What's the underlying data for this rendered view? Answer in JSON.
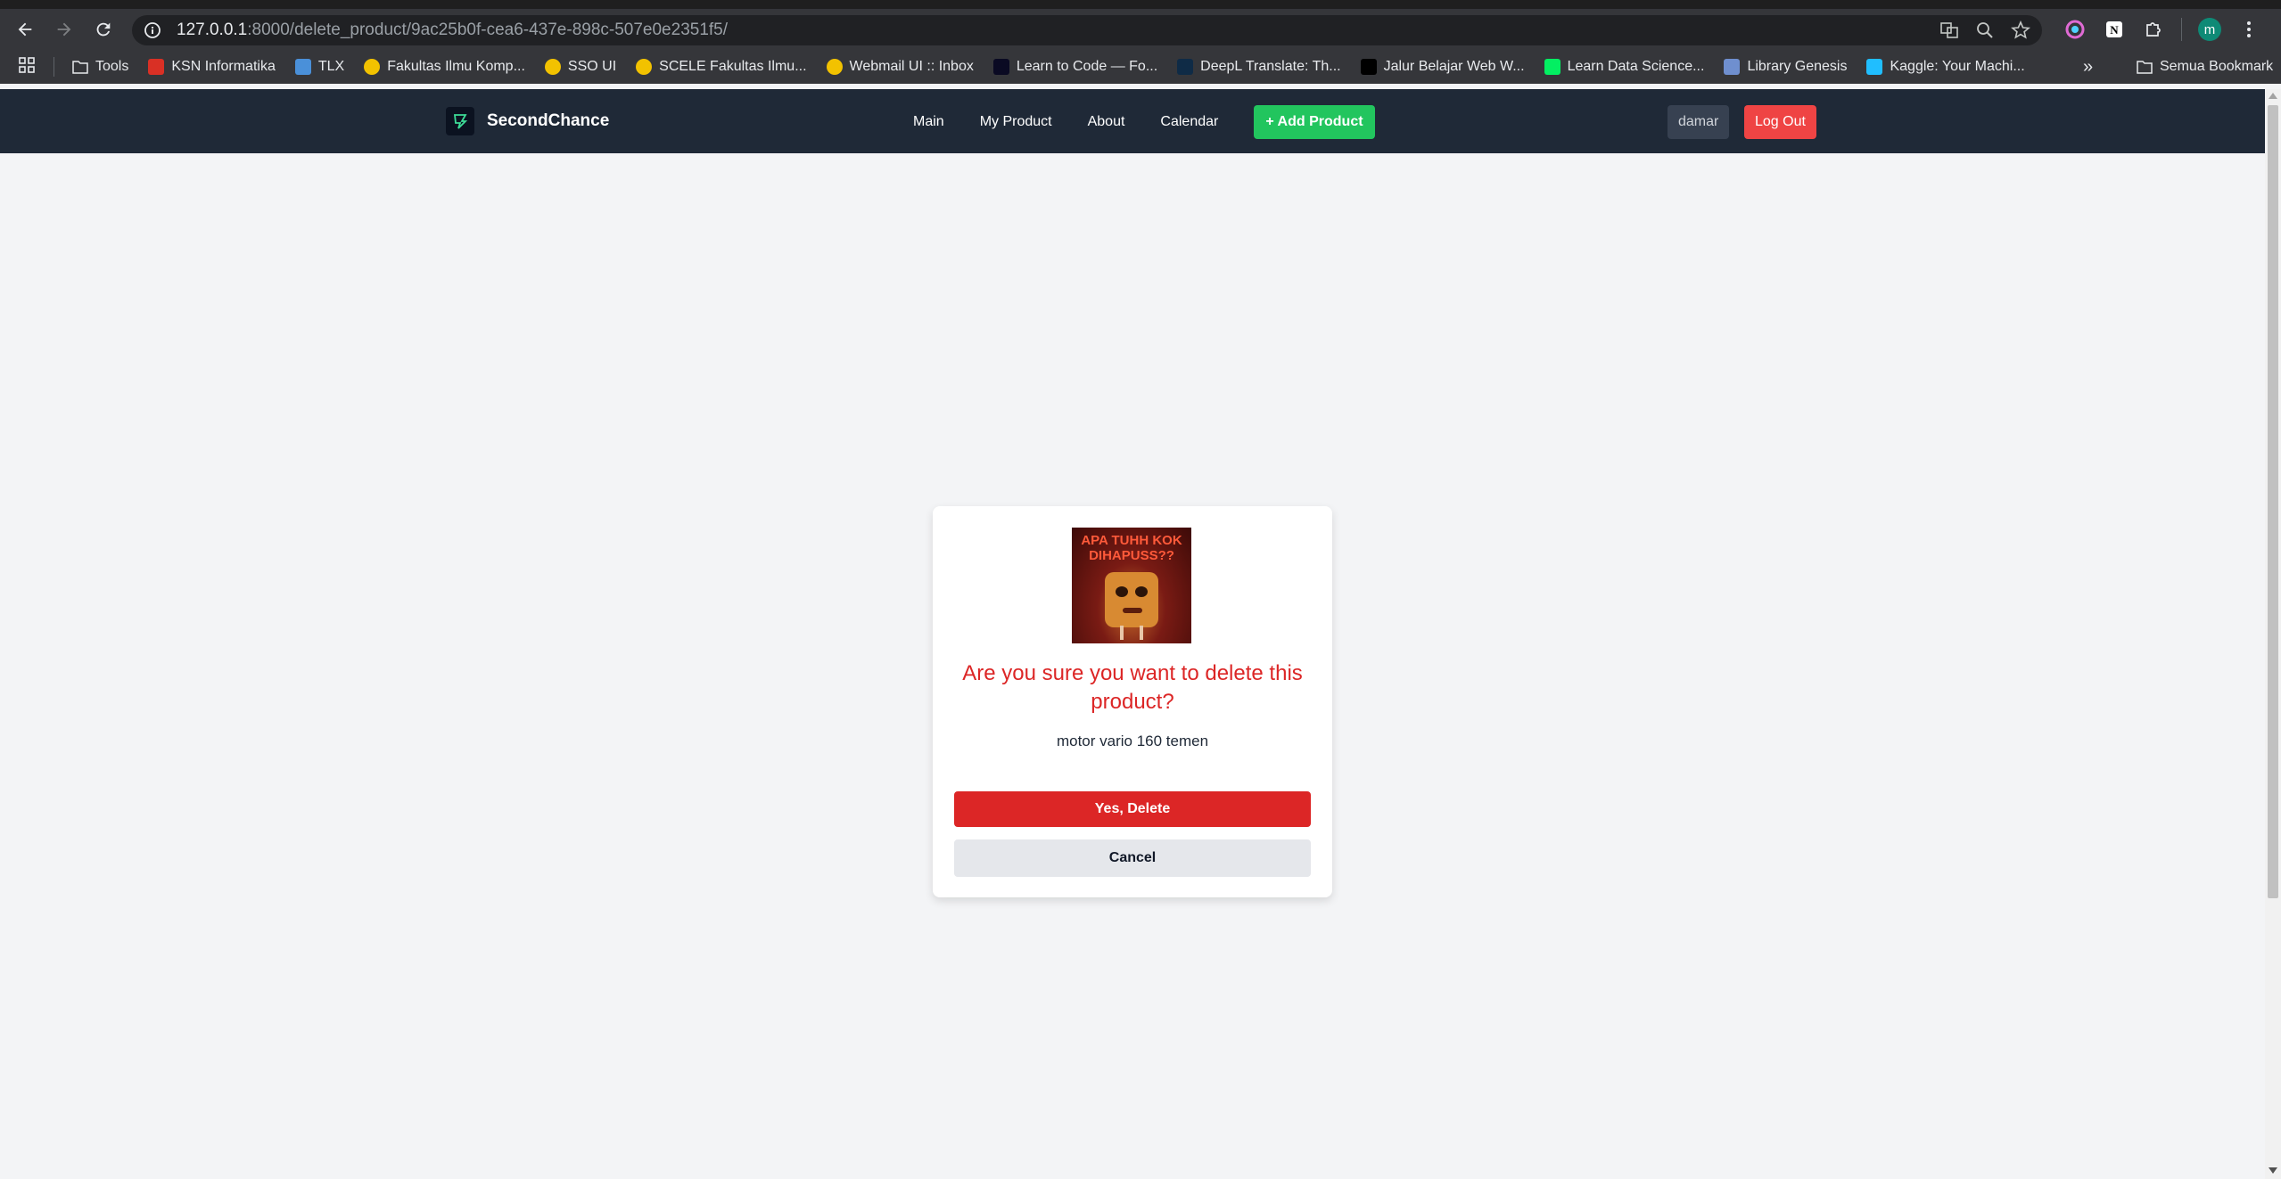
{
  "browser": {
    "url_host": "127.0.0.1",
    "url_rest": ":8000/delete_product/9ac25b0f-cea6-437e-898c-507e0e2351f5/",
    "profile_initial": "m",
    "bookmarks": [
      {
        "label": "Tools",
        "icon": "folder-icon",
        "color": "#e8eaed"
      },
      {
        "label": "KSN Informatika",
        "icon": "ksn-icon",
        "color": "#d93025"
      },
      {
        "label": "TLX",
        "icon": "tlx-icon",
        "color": "#4a90d9"
      },
      {
        "label": "Fakultas Ilmu Komp...",
        "icon": "ui-icon",
        "color": "#f2c200"
      },
      {
        "label": "SSO UI",
        "icon": "ui-icon",
        "color": "#f2c200"
      },
      {
        "label": "SCELE Fakultas Ilmu...",
        "icon": "ui-icon",
        "color": "#f2c200"
      },
      {
        "label": "Webmail UI :: Inbox",
        "icon": "ui-icon",
        "color": "#f2c200"
      },
      {
        "label": "Learn to Code — Fo...",
        "icon": "freecodecamp-icon",
        "color": "#0a0a23"
      },
      {
        "label": "DeepL Translate: Th...",
        "icon": "deepl-icon",
        "color": "#0f2b46"
      },
      {
        "label": "Jalur Belajar Web W...",
        "icon": "jalur-icon",
        "color": "#000000"
      },
      {
        "label": "Learn Data Science...",
        "icon": "datacamp-icon",
        "color": "#03ef62"
      },
      {
        "label": "Library Genesis",
        "icon": "libgen-icon",
        "color": "#6f8fcf"
      },
      {
        "label": "Kaggle: Your Machi...",
        "icon": "kaggle-icon",
        "color": "#20beff"
      }
    ],
    "all_bookmarks_label": "Semua Bookmark"
  },
  "app": {
    "brand": "SecondChance",
    "menu": [
      "Main",
      "My Product",
      "About",
      "Calendar"
    ],
    "add_product_label": "+ Add Product",
    "username": "damar",
    "logout_label": "Log Out",
    "accent": "#22c55e",
    "danger": "#dc2626"
  },
  "dialog": {
    "image_text": "APA TUHH KOK DIHAPUSS??",
    "title": "Are you sure you want to delete this product?",
    "product_name": "motor vario 160 temen",
    "confirm_label": "Yes, Delete",
    "cancel_label": "Cancel"
  }
}
